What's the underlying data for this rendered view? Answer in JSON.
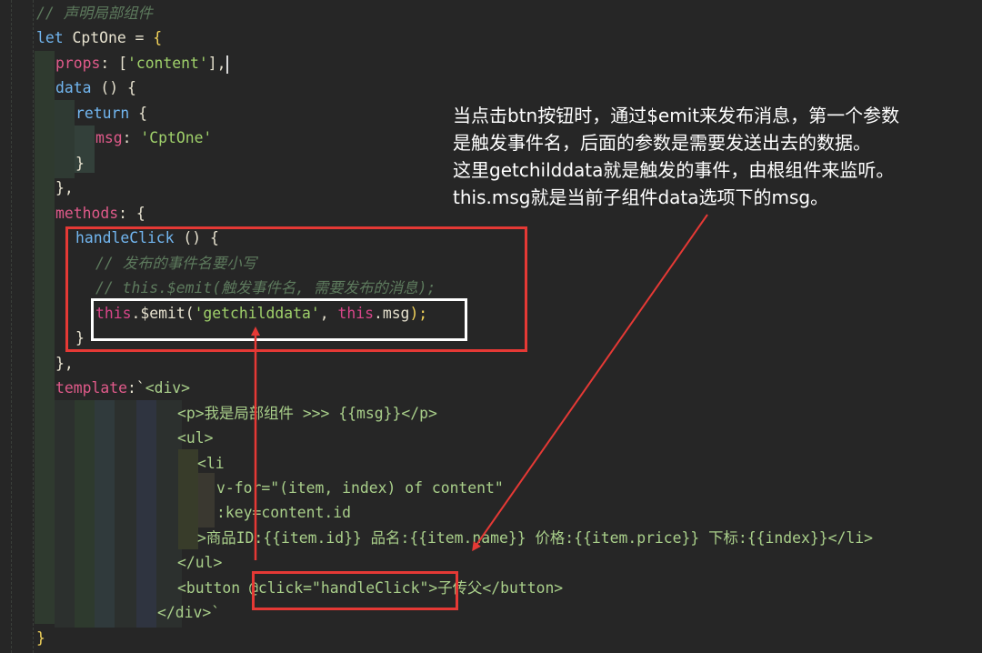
{
  "editor": {
    "theme_colors": {
      "background": "#262626",
      "comment": "#5d7a5d",
      "keyword": "#72b6f0",
      "property": "#e05a8a",
      "string": "#9fd06a",
      "this_keyword": "#d9468a",
      "template_text": "#a9cf8a",
      "bracket_highlight": "#f1d25a",
      "annotation_box_red": "#e53935",
      "annotation_box_white": "#ffffff"
    },
    "lines": {
      "l1": "// 声明局部组件",
      "l2_kw": "let",
      "l2_rest": " CptOne = ",
      "l2_brace": "{",
      "l3_prop": "props",
      "l3_colon": ": [",
      "l3_str": "'content'",
      "l3_end": "],",
      "l4_kw": "data",
      "l4_rest": " () {",
      "l5_kw": "return",
      "l5_rest": " {",
      "l6_prop": "msg",
      "l6_colon": ": ",
      "l6_str": "'CptOne'",
      "l7": "}",
      "l8": "},",
      "l9_prop": "methods",
      "l9_rest": ": {",
      "l10_fn": "handleClick",
      "l10_rest": " () {",
      "l11": "// 发布的事件名要小写",
      "l12": "// this.$emit(触发事件名, 需要发布的消息);",
      "l13_this": "this",
      "l13_emit": ".$emit(",
      "l13_str": "'getchilddata'",
      "l13_comma": ", ",
      "l13_this2": "this",
      "l13_msg": ".msg",
      "l13_end": ");",
      "l14": "}",
      "l15": "},",
      "l16_prop": "template",
      "l16_rest": ":`",
      "l16_tag": "<div>",
      "l17": "<p>我是局部组件 >>> {{msg}}</p>",
      "l18": "<ul>",
      "l19": "<li",
      "l20": "v-for=\"(item, index) of content\"",
      "l21": ":key=content.id",
      "l22": ">商品ID:{{item.id}} 品名:{{item.name}} 价格:{{item.price}} 下标:{{index}}</li>",
      "l23": "</ul>",
      "l24_open": "<button ",
      "l24_attr": "@click=\"handleClick\"",
      "l24_close": ">子传父</button>",
      "l25": "</div>`",
      "l26": "}"
    }
  },
  "annotation": {
    "line1": "当点击btn按钮时，通过$emit来发布消息，第一个参数",
    "line2": "是触发事件名，后面的参数是需要发送出去的数据。",
    "line3": "这里getchilddata就是触发的事件，由根组件来监听。",
    "line4": "this.msg就是当前子组件data选项下的msg。"
  }
}
